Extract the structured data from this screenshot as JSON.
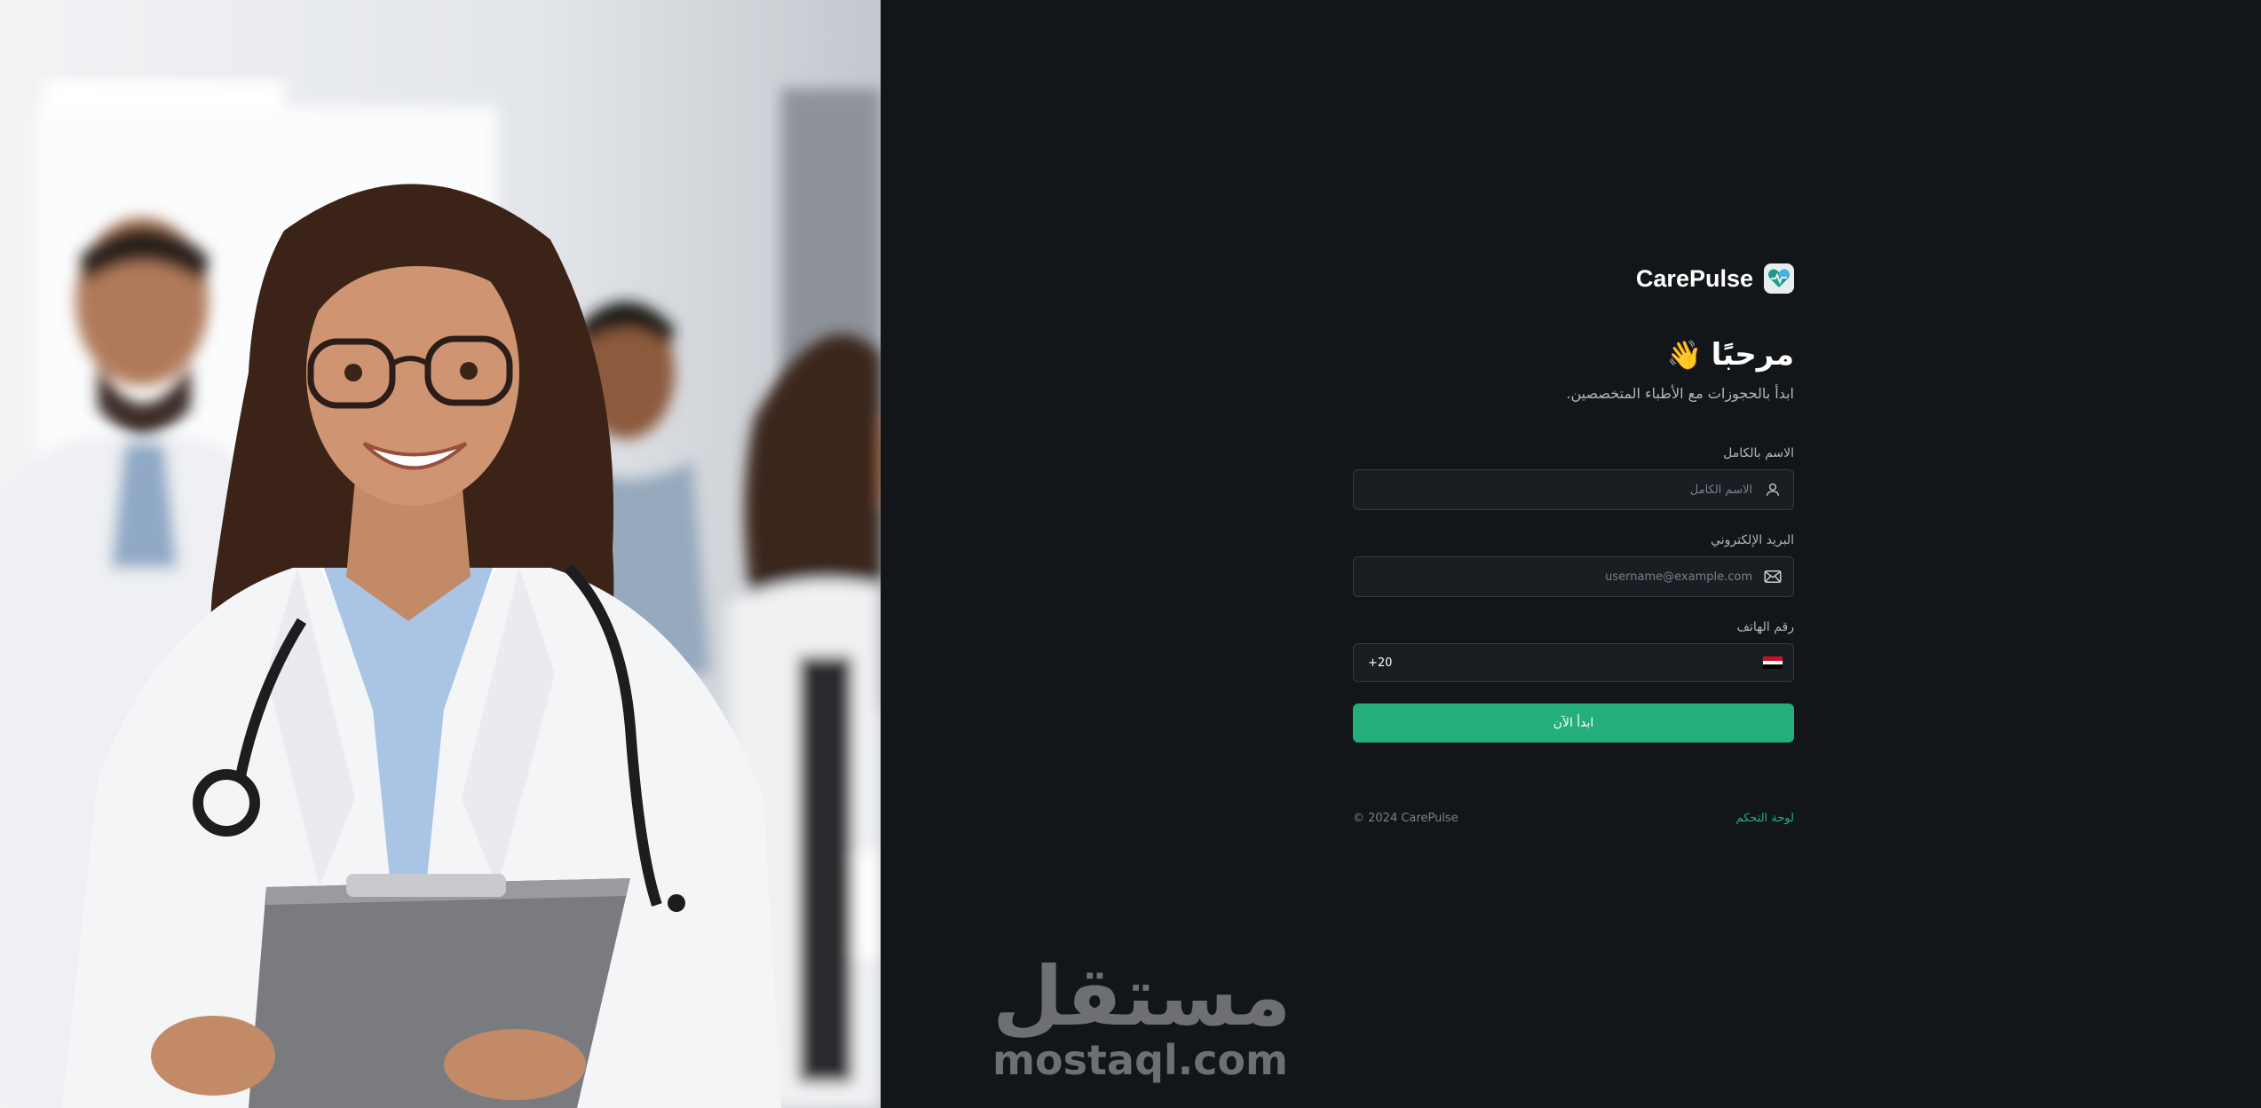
{
  "brand": {
    "name": "CarePulse",
    "logo_icon": "carepulse-heart-logo-icon"
  },
  "welcome": {
    "title": "مرحبًا",
    "emoji": "👋",
    "subtitle": "ابدأ بالحجوزات مع الأطباء المتخصصين."
  },
  "form": {
    "name": {
      "label": "الاسم بالكامل",
      "placeholder": "الاسم الكامل",
      "value": "",
      "icon": "user-icon"
    },
    "email": {
      "label": "البريد الإلكتروني",
      "placeholder": "username@example.com",
      "value": "",
      "icon": "mail-icon"
    },
    "phone": {
      "label": "رقم الهاتف",
      "value": "+20",
      "country_flag_icon": "egypt-flag-icon"
    },
    "submit_label": "ابدأ الآن"
  },
  "footer": {
    "link_label": "لوحة التحكم",
    "copyright": "© 2024 CarePulse"
  },
  "watermark": {
    "arabic": "مستقل",
    "latin": "mostaql.com"
  },
  "colors": {
    "background": "#131619",
    "accent": "#24ae7c",
    "input_bg": "#1a1d21",
    "input_border": "#363a3d",
    "muted_text": "#abb8c4"
  }
}
